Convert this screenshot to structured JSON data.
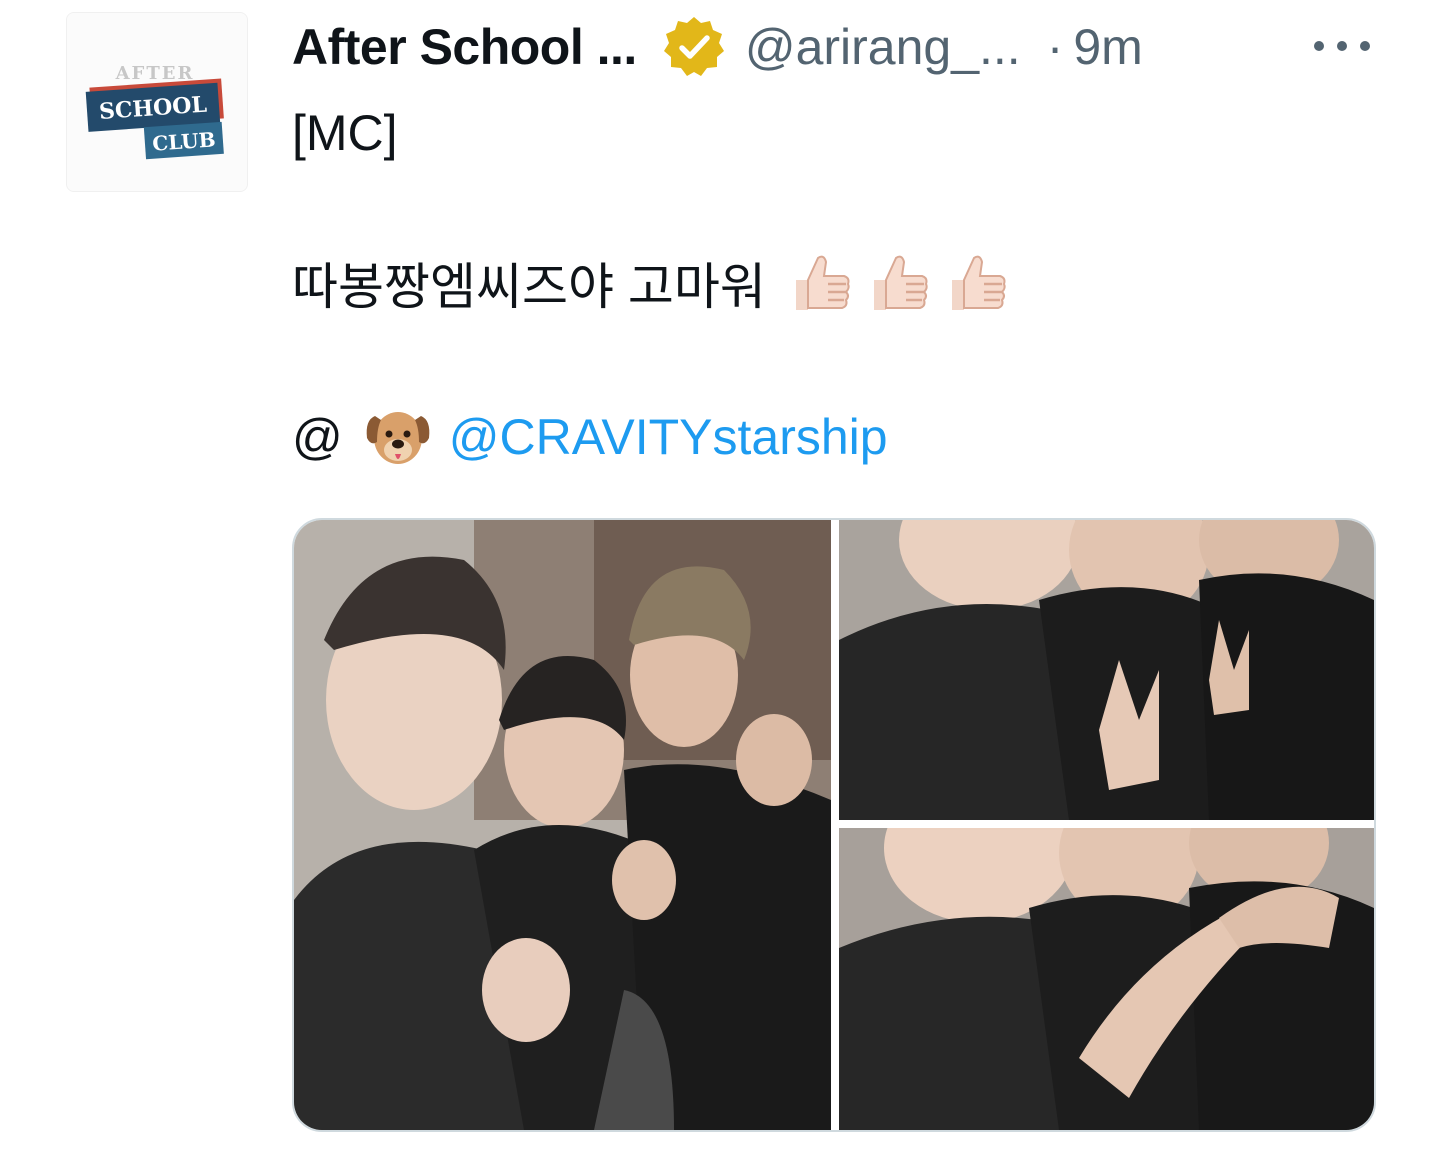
{
  "tweet": {
    "display_name": "After School ...",
    "handle": "@arirang_...",
    "separator": "·",
    "time": "9m",
    "line1": "[MC]",
    "line2": "따봉짱엠씨즈야 고마워",
    "at_prefix": "@",
    "mention": "@CRAVITYstarship",
    "thumbs_count": 3
  },
  "avatar": {
    "logo_top": "AFTER",
    "logo_mid": "SCHOOL",
    "logo_bottom": "CLUB"
  },
  "icons": {
    "verified": "verified-badge-icon",
    "more": "more-dots-icon",
    "thumbs": "thumbs-up-emoji",
    "dog": "dog-face-emoji"
  },
  "colors": {
    "link": "#1d9bf0",
    "verified_gold": "#e2b719",
    "secondary_text": "#536471",
    "media_border": "#cfd9de"
  }
}
